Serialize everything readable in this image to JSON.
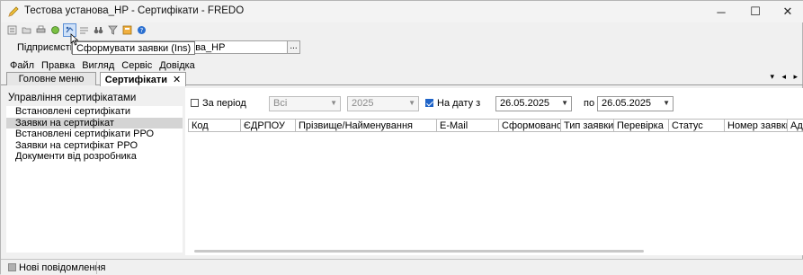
{
  "window": {
    "title": "Тестова установа_HP - Сертифікати - FREDO",
    "controls": {
      "minimize": "─",
      "maximize": "☐",
      "close": "✕"
    }
  },
  "toolbar": {
    "icons": [
      "list-icon",
      "folder-icon",
      "print-icon",
      "refresh-icon",
      "generate-requests-icon",
      "edit-icon",
      "binoculars-icon",
      "filter-icon",
      "export-icon",
      "help-icon"
    ],
    "tooltip": "Сформувати заявки (Ins)"
  },
  "enterprise": {
    "label": "Підприємств",
    "value": "нова_HP",
    "browse_label": "..."
  },
  "menu": [
    "Файл",
    "Правка",
    "Вигляд",
    "Сервіс",
    "Довідка"
  ],
  "tabs": [
    {
      "label": "Головне меню"
    },
    {
      "label": "Сертифікати",
      "close": "✕"
    }
  ],
  "tab_nav": "▾ ◂ ▸",
  "left_panel": {
    "title": "Управління сертифікатами",
    "items": [
      "Встановлені сертифікати",
      "Заявки на сертифікат",
      "Встановлені сертифікати РРО",
      "Заявки на сертифікат РРО",
      "Документи від розробника"
    ],
    "selected_index": 1
  },
  "filters": {
    "period_label": "За період",
    "period_checked": false,
    "all_value": "Всі",
    "year_value": "2025",
    "on_date_label": "На дату з",
    "on_date_checked": true,
    "date_from": "26.05.2025",
    "to_label": "по",
    "date_to": "26.05.2025"
  },
  "grid": {
    "columns": [
      "Код",
      "ЄДРПОУ",
      "Прізвище/Найменування",
      "E-Mail",
      "Сформовано",
      "Тип заявки",
      "Перевірка",
      "Статус",
      "Номер заявки",
      "Ад"
    ],
    "rows": []
  },
  "statusbar": {
    "text": "Нові повідомлення"
  },
  "colors": {
    "selection": "#d4d4d4",
    "checkbox_accent": "#1f64c8",
    "toolbar_active": "#cfe1f8"
  }
}
